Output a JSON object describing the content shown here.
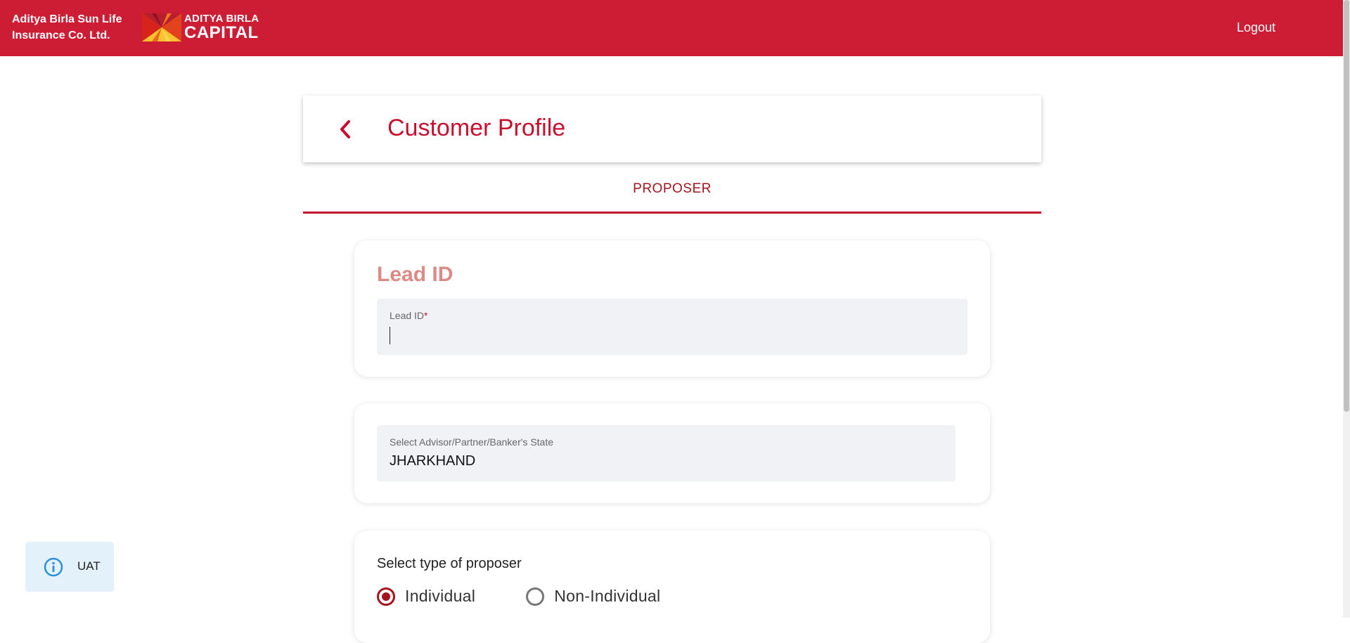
{
  "header": {
    "company_line1": "Aditya Birla Sun Life",
    "company_line2": "Insurance Co. Ltd.",
    "logo_line1": "ADITYA BIRLA",
    "logo_line2": "CAPITAL",
    "logout_label": "Logout",
    "brand_color": "#cc1d35"
  },
  "page": {
    "title": "Customer Profile",
    "back_icon": "chevron-left-icon"
  },
  "tabs": [
    {
      "label": "PROPOSER",
      "active": true
    }
  ],
  "lead_section": {
    "heading": "Lead ID",
    "field_label": "Lead ID",
    "required_marker": "*",
    "value": ""
  },
  "state_section": {
    "field_label": "Select Advisor/Partner/Banker's State",
    "value": "JHARKHAND"
  },
  "proposer_section": {
    "title": "Select type of proposer",
    "options": [
      {
        "label": "Individual",
        "checked": true
      },
      {
        "label": "Non-Individual",
        "checked": false
      }
    ]
  },
  "env_badge": {
    "icon": "info-icon",
    "label": "UAT"
  }
}
